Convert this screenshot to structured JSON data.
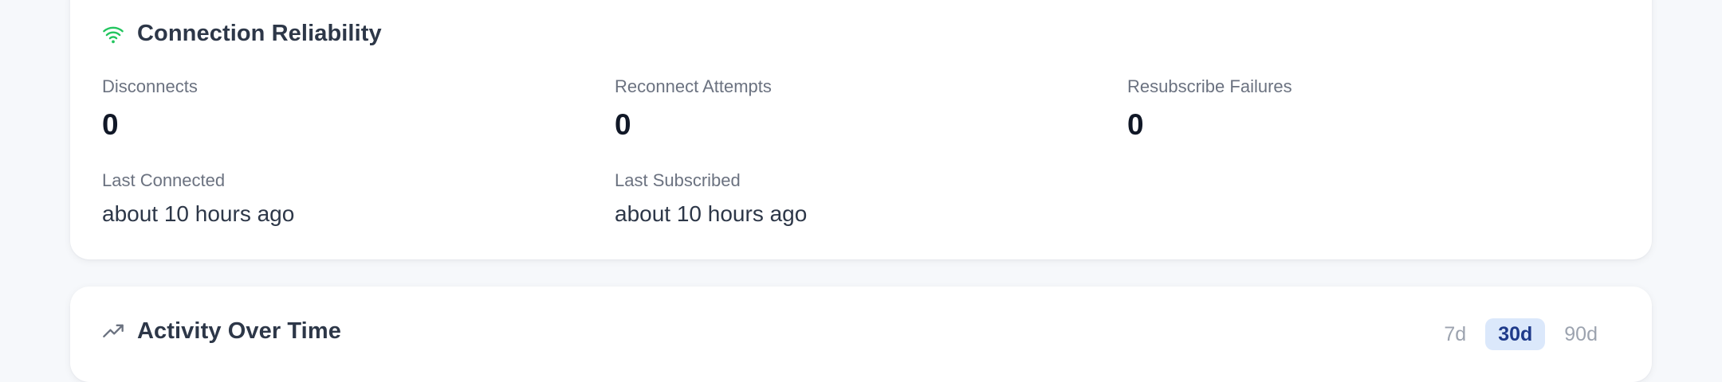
{
  "reliability": {
    "title": "Connection Reliability",
    "icon": "wifi-icon",
    "icon_color": "#22c55e",
    "stats": {
      "disconnects": {
        "label": "Disconnects",
        "value": "0"
      },
      "reconnect_attempts": {
        "label": "Reconnect Attempts",
        "value": "0"
      },
      "resubscribe_failures": {
        "label": "Resubscribe Failures",
        "value": "0"
      },
      "last_connected": {
        "label": "Last Connected",
        "value": "about 10 hours ago"
      },
      "last_subscribed": {
        "label": "Last Subscribed",
        "value": "about 10 hours ago"
      }
    }
  },
  "activity": {
    "title": "Activity Over Time",
    "icon": "trending-up-icon",
    "ranges": [
      "7d",
      "30d",
      "90d"
    ],
    "selected_range": "30d",
    "accent_color": "#1e3a8a"
  }
}
